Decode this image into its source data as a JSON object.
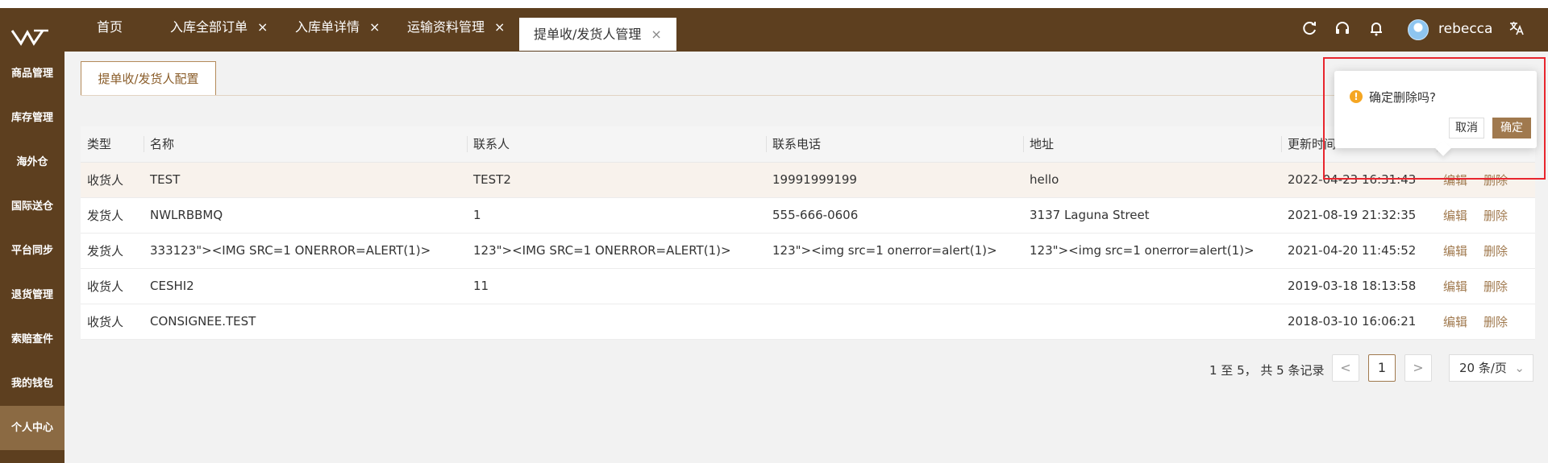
{
  "header": {
    "tabs": [
      {
        "label": "首页",
        "closable": false
      },
      {
        "label": "入库全部订单",
        "closable": true
      },
      {
        "label": "入库单详情",
        "closable": true
      },
      {
        "label": "运输资料管理",
        "closable": true
      },
      {
        "label": "提单收/发货人管理",
        "closable": true,
        "active": true
      }
    ],
    "close_glyph": "×",
    "username": "rebecca",
    "icons": [
      "refresh-icon",
      "headset-icon",
      "bell-icon",
      "avatar",
      "translate-icon"
    ]
  },
  "sidebar": {
    "items": [
      {
        "label": "商品管理"
      },
      {
        "label": "库存管理"
      },
      {
        "label": "海外仓"
      },
      {
        "label": "国际送仓"
      },
      {
        "label": "平台同步"
      },
      {
        "label": "退货管理"
      },
      {
        "label": "索赔查件"
      },
      {
        "label": "我的钱包"
      },
      {
        "label": "个人中心",
        "active": true
      }
    ]
  },
  "subtab": {
    "label": "提单收/发货人配置"
  },
  "table": {
    "columns": [
      "类型",
      "名称",
      "联系人",
      "联系电话",
      "地址",
      "更新时间"
    ],
    "rows": [
      {
        "type": "收货人",
        "name": "TEST",
        "contact": "TEST2",
        "phone": "19991999199",
        "address": "hello",
        "updated": "2022-04-23 16:31:43"
      },
      {
        "type": "发货人",
        "name": "NWLRBBMQ",
        "contact": "1",
        "phone": "555-666-0606",
        "address": "3137 Laguna Street",
        "updated": "2021-08-19 21:32:35"
      },
      {
        "type": "发货人",
        "name": "333123\"><IMG SRC=1 ONERROR=ALERT(1)>",
        "contact": "123\"><IMG SRC=1 ONERROR=ALERT(1)>",
        "phone": "123\"><img src=1 onerror=alert(1)>",
        "address": "123\"><img src=1 onerror=alert(1)>",
        "updated": "2021-04-20 11:45:52"
      },
      {
        "type": "收货人",
        "name": "CESHI2",
        "contact": "11",
        "phone": "",
        "address": "",
        "updated": "2019-03-18 18:13:58"
      },
      {
        "type": "收货人",
        "name": "CONSIGNEE.TEST",
        "contact": "",
        "phone": "",
        "address": "",
        "updated": "2018-03-10 16:06:21"
      }
    ],
    "edit_label": "编辑",
    "delete_label": "删除"
  },
  "pagination": {
    "info": "1 至 5， 共 5 条记录",
    "current_page": "1",
    "prev_glyph": "<",
    "next_glyph": ">",
    "page_size": "20 条/页"
  },
  "popconfirm": {
    "message": "确定删除吗?",
    "cancel_label": "取消",
    "ok_label": "确定",
    "warn_glyph": "!"
  },
  "colors": {
    "brand": "#5d3f1f",
    "accent": "#a0794e",
    "highlight_box": "#e8262e"
  }
}
